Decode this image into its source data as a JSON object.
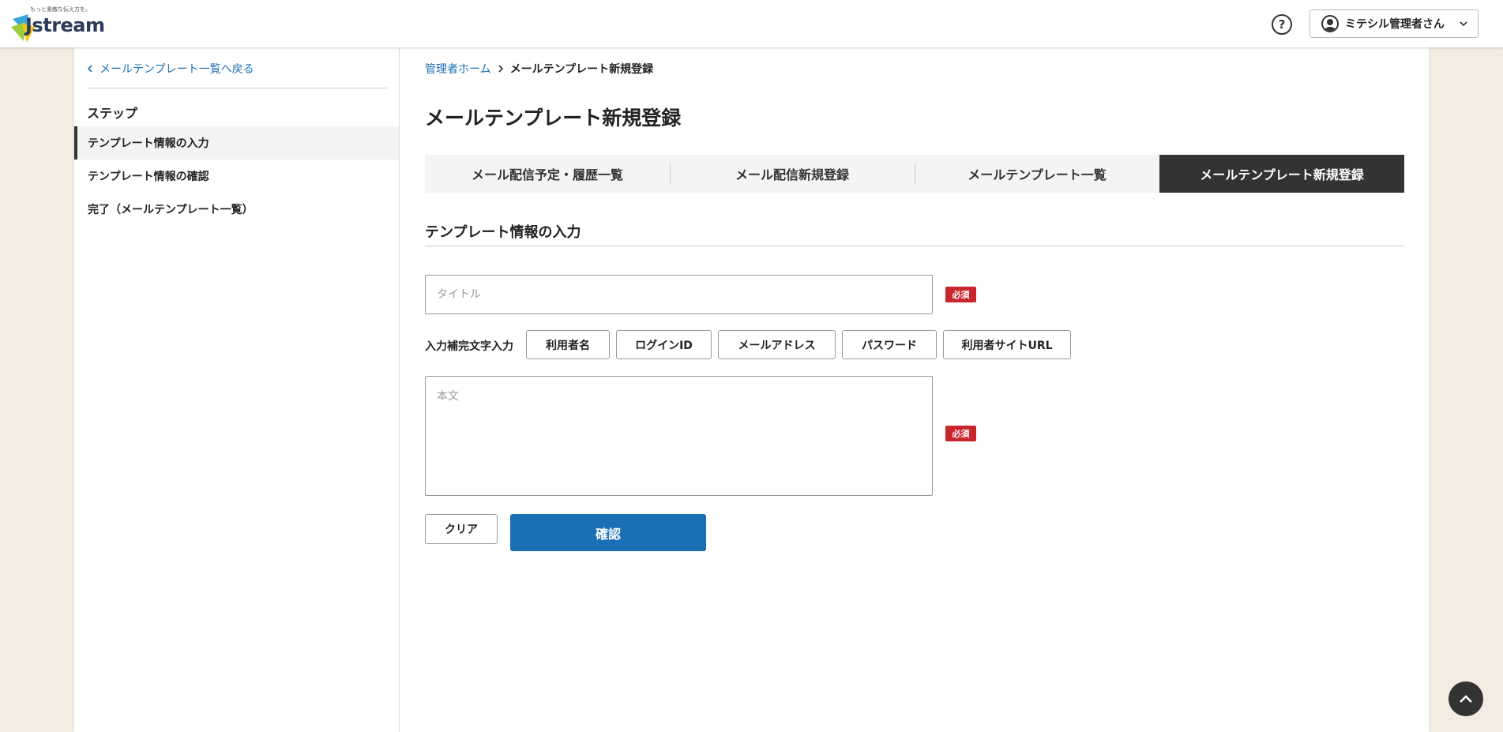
{
  "header": {
    "logo_tagline": "もっと素敵な伝え方を。",
    "logo_text": "Jstream",
    "help_icon": "help-circle-icon",
    "user_name": "ミテシル管理者さん",
    "user_icon": "user-circle-icon",
    "dropdown_icon": "chevron-down-icon"
  },
  "sidebar": {
    "back_link": "メールテンプレート一覧へ戻る",
    "step_heading": "ステップ",
    "steps": [
      {
        "label": "テンプレート情報の入力",
        "active": true
      },
      {
        "label": "テンプレート情報の確認",
        "active": false
      },
      {
        "label": "完了（メールテンプレート一覧）",
        "active": false
      }
    ]
  },
  "breadcrumb": {
    "home": "管理者ホーム",
    "current": "メールテンプレート新規登録"
  },
  "page_title": "メールテンプレート新規登録",
  "tabs": [
    {
      "label": "メール配信予定・履歴一覧",
      "active": false
    },
    {
      "label": "メール配信新規登録",
      "active": false
    },
    {
      "label": "メールテンプレート一覧",
      "active": false
    },
    {
      "label": "メールテンプレート新規登録",
      "active": true
    }
  ],
  "form": {
    "section_title": "テンプレート情報の入力",
    "title_placeholder": "タイトル",
    "title_value": "",
    "required_label": "必須",
    "complement_label": "入力補完文字入力",
    "complement_chips": [
      "利用者名",
      "ログインID",
      "メールアドレス",
      "パスワード",
      "利用者サイトURL"
    ],
    "body_placeholder": "本文",
    "body_value": "",
    "clear_label": "クリア",
    "confirm_label": "確認"
  },
  "colors": {
    "accent": "#1a6fb5",
    "required": "#c8252c",
    "active_tab": "#333333",
    "page_bg": "#f2ece2"
  },
  "page_top_icon": "chevron-up-icon"
}
